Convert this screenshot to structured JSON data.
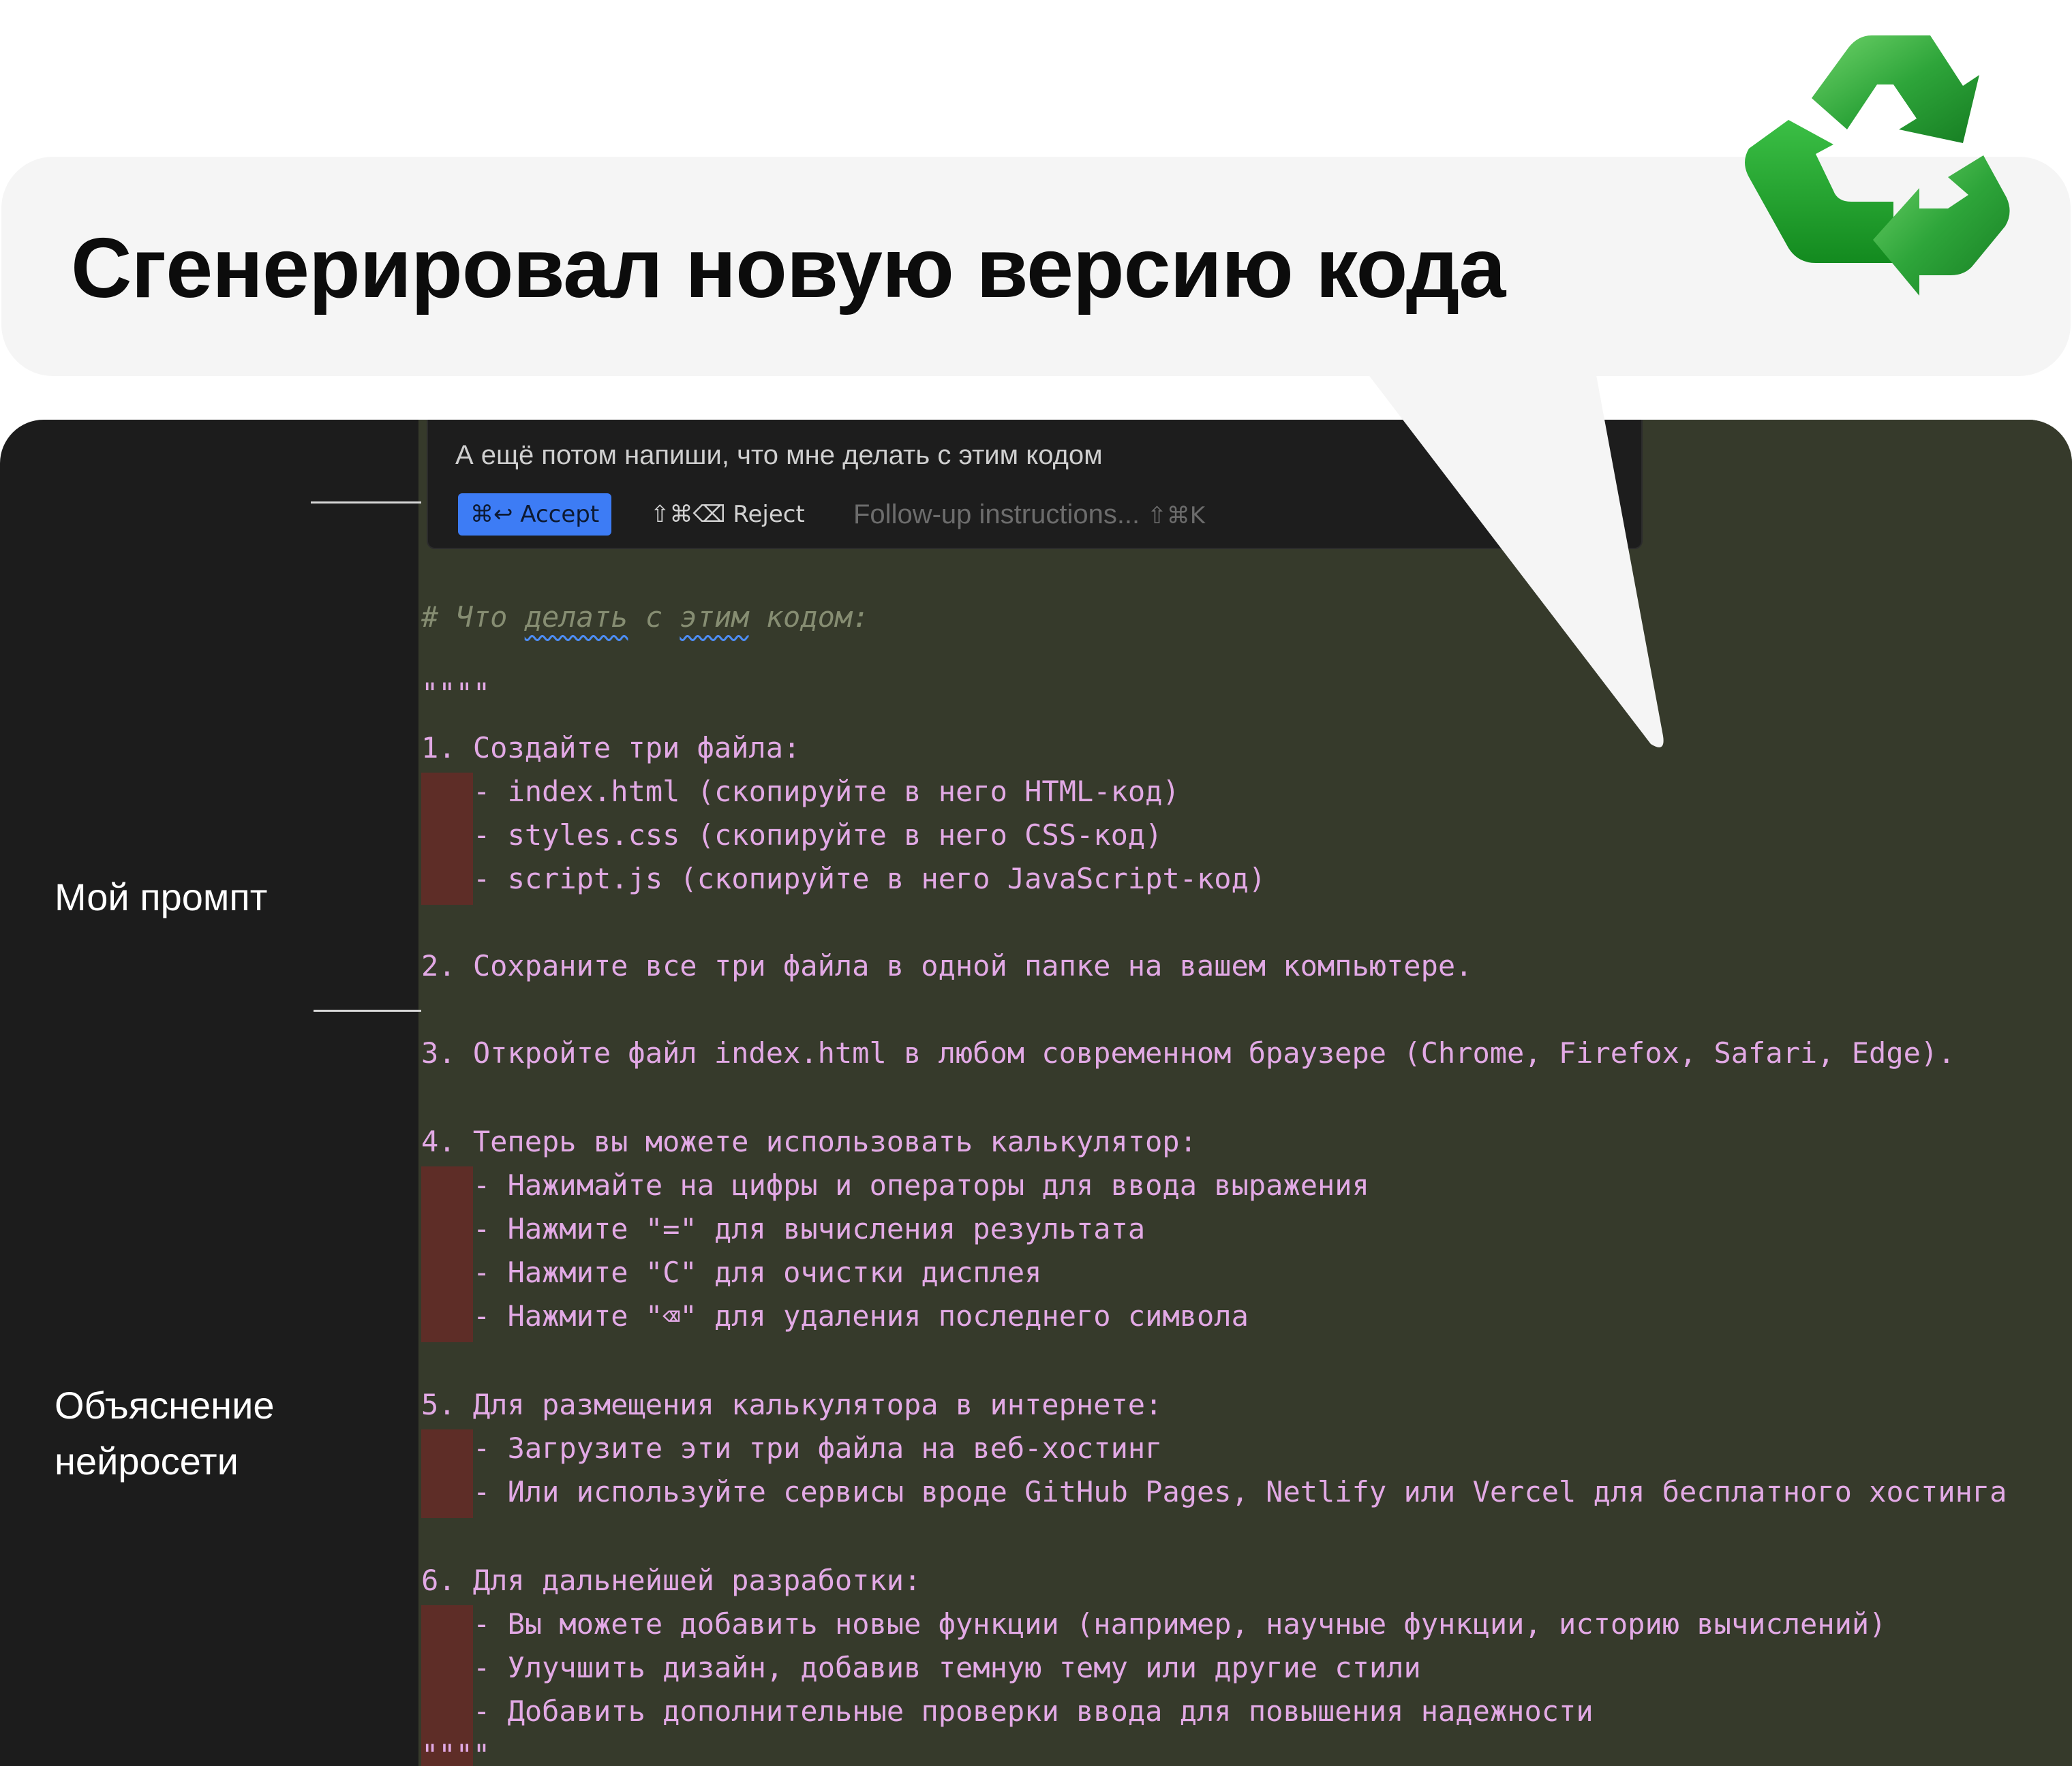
{
  "title": "Сгенерировал новую версию кода",
  "labels": {
    "prompt": "Мой промпт",
    "explanation": [
      "Объяснение",
      "нейросети"
    ]
  },
  "prompt_box": {
    "text": "А ещё потом напиши, что мне делать с этим кодом",
    "accept": "⌘↩ Accept",
    "reject": "⇧⌘⌫ Reject",
    "follow_up": "Follow-up instructions...",
    "follow_up_shortcut": "⇧⌘K"
  },
  "code": {
    "comment": "# Что делать с этим кодом:",
    "comment_parts": [
      "# Что ",
      "делать",
      " с ",
      "этим",
      " кодом:"
    ],
    "quotes_open": "\"\"\"\"",
    "lines": [
      "1. Создайте три файла:",
      "- index.html (скопируйте в него HTML-код)",
      "- styles.css (скопируйте в него CSS-код)",
      "- script.js (скопируйте в него JavaScript-код)",
      "2. Сохраните все три файла в одной папке на вашем компьютере.",
      "3. Откройте файл index.html в любом современном браузере (Chrome, Firefox, Safari, Edge).",
      "4. Теперь вы можете использовать калькулятор:",
      "- Нажимайте на цифры и операторы для ввода выражения",
      "- Нажмите \"=\" для вычисления результата",
      "- Нажмите \"C\" для очистки дисплея",
      "- Нажмите \"⌫\" для удаления последнего символа",
      "5. Для размещения калькулятора в интернете:",
      "- Загрузите эти три файла на веб-хостинг",
      "- Или используйте сервисы вроде GitHub Pages, Netlify или Vercel для бесплатного хостинга",
      "6. Для дальнейшей разработки:",
      "- Вы можете добавить новые функции (например, научные функции, историю вычислений)",
      "- Улучшить дизайн, добавив темную тему или другие стили",
      "- Добавить дополнительные проверки ввода для повышения надежности"
    ],
    "quotes_close": "\"\"\"\""
  },
  "colors": {
    "code_text": "#e2a9e5",
    "comment": "#868d72",
    "editor_bg": "#363a2b",
    "panel_bg": "#1c1c1c",
    "accept_button": "#3d7cf5",
    "deleted_marker": "#5e2d27",
    "recycle_green": "#22a52e"
  },
  "icons": [
    "recycle-icon"
  ]
}
